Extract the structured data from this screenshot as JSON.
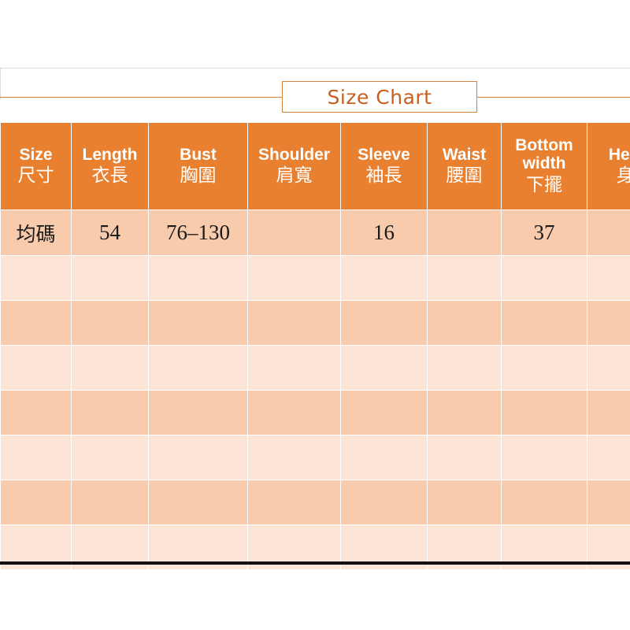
{
  "page": {
    "title_label": "Size Chart"
  },
  "table": {
    "headers": [
      {
        "en": "Size",
        "zh": "尺寸"
      },
      {
        "en": "Length",
        "zh": "衣長"
      },
      {
        "en": "Bust",
        "zh": "胸圍"
      },
      {
        "en": "Shoulder",
        "zh": "肩寬"
      },
      {
        "en": "Sleeve",
        "zh": "袖長"
      },
      {
        "en": "Waist",
        "zh": "腰圍"
      },
      {
        "en": "Bottom width",
        "zh": "下擺"
      },
      {
        "en": "Height",
        "zh": "身高"
      }
    ],
    "rows": [
      {
        "size": "均碼",
        "length": "54",
        "bust": "76–130",
        "shoulder": "",
        "sleeve": "16",
        "waist": "",
        "bottom_width": "37",
        "height": ""
      }
    ],
    "empty_row_count": 7
  },
  "colors": {
    "header_orange": "#e8802f",
    "row_dark_peach": "#f8cbad",
    "row_light_peach": "#fce4d6",
    "title_accent": "#c7601f",
    "title_border": "#d2833f",
    "grid_line": "#ffffff",
    "bottom_rule": "#111111"
  }
}
